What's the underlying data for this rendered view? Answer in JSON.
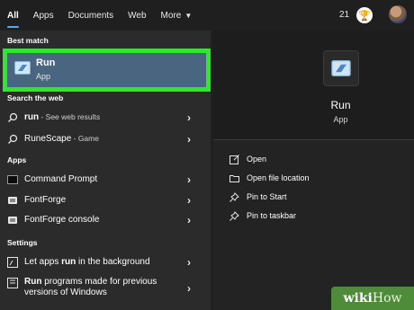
{
  "tabs": [
    {
      "label": "All",
      "active": true
    },
    {
      "label": "Apps"
    },
    {
      "label": "Documents"
    },
    {
      "label": "Web"
    },
    {
      "label": "More"
    }
  ],
  "header": {
    "points": "21"
  },
  "sections": {
    "best_match": "Best match",
    "search_web": "Search the web",
    "apps": "Apps",
    "settings": "Settings"
  },
  "best_match": {
    "title": "Run",
    "subtitle": "App"
  },
  "web_results": [
    {
      "bold": "run",
      "suffix": " - See web results"
    },
    {
      "bold": "RuneScape",
      "suffix": " - Game"
    }
  ],
  "apps": [
    {
      "label": "Command Prompt"
    },
    {
      "label": "FontForge"
    },
    {
      "label": "FontForge console"
    }
  ],
  "settings_items": [
    {
      "prefix": "Let apps ",
      "bold": "run",
      "suffix": " in the background"
    },
    {
      "bold": "Run",
      "suffix": " programs made for previous versions of Windows"
    }
  ],
  "preview": {
    "title": "Run",
    "subtitle": "App"
  },
  "actions": [
    {
      "label": "Open",
      "icon": "open-icon"
    },
    {
      "label": "Open file location",
      "icon": "folder-icon"
    },
    {
      "label": "Pin to Start",
      "icon": "pin-icon"
    },
    {
      "label": "Pin to taskbar",
      "icon": "pin-icon"
    }
  ],
  "watermark": {
    "part1": "wiki",
    "part2": "How"
  },
  "colors": {
    "highlight_border": "#2ee82e",
    "selected_bg": "#4a6580",
    "accent": "#5aa9e6"
  }
}
